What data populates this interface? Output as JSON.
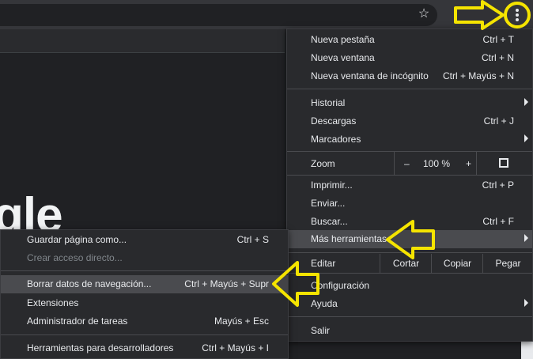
{
  "toolbar": {
    "star_icon": "bookmark-star-icon",
    "menu_icon": "three-dot-menu-icon"
  },
  "content": {
    "logo_text": "gle"
  },
  "main_menu": {
    "items": [
      {
        "label": "Nueva pestaña",
        "shortcut": "Ctrl + T"
      },
      {
        "label": "Nueva ventana",
        "shortcut": "Ctrl + N"
      },
      {
        "label": "Nueva ventana de incógnito",
        "shortcut": "Ctrl + Mayús + N"
      },
      {
        "label": "Historial"
      },
      {
        "label": "Descargas",
        "shortcut": "Ctrl + J"
      },
      {
        "label": "Marcadores"
      },
      {
        "label": "Imprimir...",
        "shortcut": "Ctrl + P"
      },
      {
        "label": "Enviar..."
      },
      {
        "label": "Buscar...",
        "shortcut": "Ctrl + F"
      },
      {
        "label": "Más herramientas"
      },
      {
        "label": "Configuración"
      },
      {
        "label": "Ayuda"
      },
      {
        "label": "Salir"
      }
    ],
    "zoom": {
      "label": "Zoom",
      "minus": "–",
      "level": "100 %",
      "plus": "+"
    },
    "edit": {
      "label": "Editar",
      "cut": "Cortar",
      "copy": "Copiar",
      "paste": "Pegar"
    }
  },
  "sub_menu": {
    "items": [
      {
        "label": "Guardar página como...",
        "shortcut": "Ctrl + S"
      },
      {
        "label": "Crear acceso directo..."
      },
      {
        "label": "Borrar datos de navegación...",
        "shortcut": "Ctrl + Mayús + Supr"
      },
      {
        "label": "Extensiones"
      },
      {
        "label": "Administrador de tareas",
        "shortcut": "Mayús + Esc"
      },
      {
        "label": "Herramientas para desarrolladores",
        "shortcut": "Ctrl + Mayús + I"
      }
    ]
  },
  "annotations": {
    "arrow_color": "#f5e400",
    "arrow_icon": "yellow-arrow-icon",
    "circle_icon": "highlight-circle-icon"
  }
}
